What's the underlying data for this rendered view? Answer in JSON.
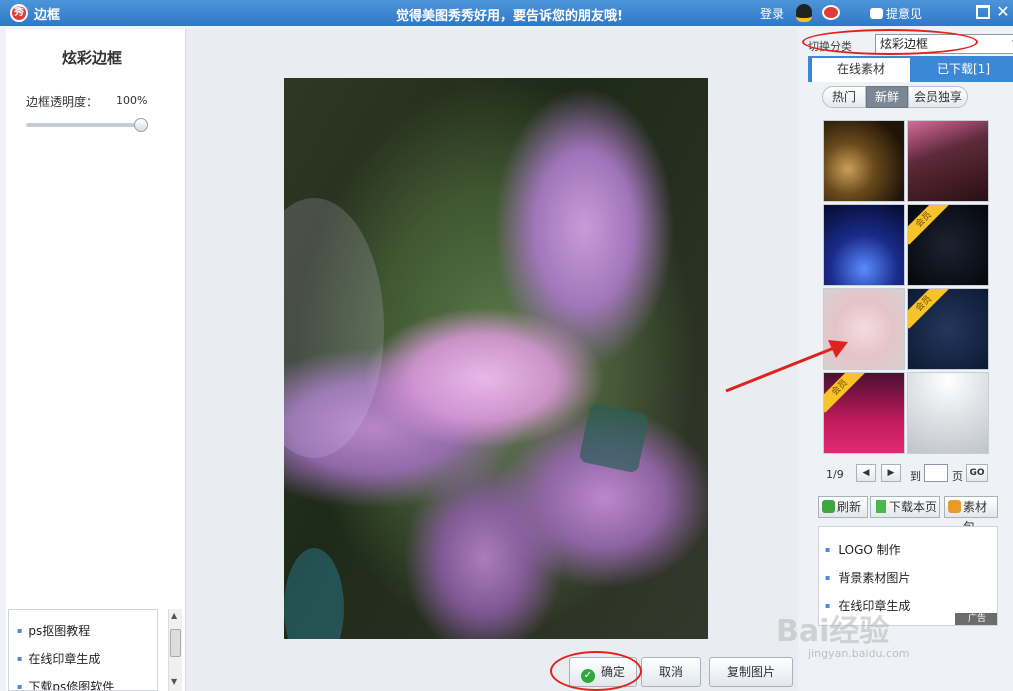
{
  "titlebar": {
    "app_icon": "秀",
    "title": "边框",
    "slogan": "觉得美图秀秀好用，要告诉您的朋友哦!",
    "login": "登录",
    "feedback": "提意见",
    "close_glyph": "✕"
  },
  "left": {
    "title": "炫彩边框",
    "opacity_label": "边框透明度：",
    "opacity_value": "100%",
    "opacity_level": 1.0,
    "tutorials": [
      "ps抠图教程",
      "在线印章生成",
      "下载ps修图软件"
    ]
  },
  "canvas": {
    "buttons": {
      "confirm": "确定",
      "cancel": "取消",
      "copy": "复制图片"
    }
  },
  "right": {
    "category_label": "切换分类",
    "category_value": "炫彩边框",
    "tabs": {
      "online": "在线素材",
      "downloaded": "已下载[1]"
    },
    "filters": [
      "热门",
      "新鲜",
      "会员独享"
    ],
    "active_filter": "新鲜",
    "thumbnails": [
      {
        "vip": false
      },
      {
        "vip": false
      },
      {
        "vip": false
      },
      {
        "vip": true
      },
      {
        "vip": false
      },
      {
        "vip": true
      },
      {
        "vip": true
      },
      {
        "vip": false
      }
    ],
    "vip_badge": "会员",
    "pager": {
      "page_info": "1/9",
      "goto_label": "到",
      "page_unit": "页",
      "go": "GO"
    },
    "actions": {
      "refresh": "刷新",
      "download_page": "下载本页",
      "material_pack": "素材包"
    },
    "links": [
      "LOGO 制作",
      "背景素材图片",
      "在线印章生成"
    ],
    "ad_tag": "广告"
  },
  "watermark": {
    "main": "Bai经验",
    "sub": "jingyan.baidu.com"
  },
  "colors": {
    "accent": "#3b89d6",
    "annotation": "#e0231c",
    "titlebar": "#2f78c7"
  }
}
